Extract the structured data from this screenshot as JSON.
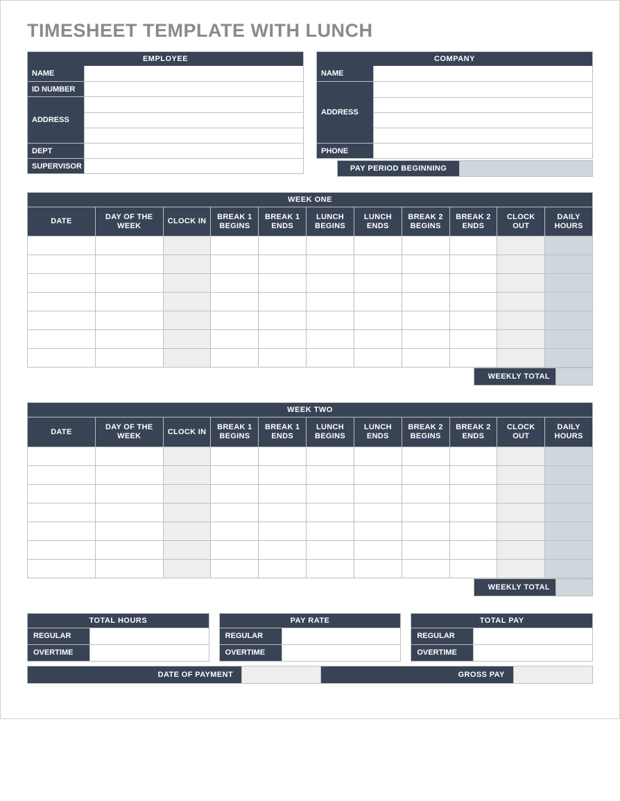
{
  "title": "TIMESHEET TEMPLATE WITH LUNCH",
  "employee": {
    "heading": "EMPLOYEE",
    "fields": {
      "name": "NAME",
      "id_number": "ID NUMBER",
      "address": "ADDRESS",
      "dept": "DEPT",
      "supervisor": "SUPERVISOR"
    },
    "values": {
      "name": "",
      "id_number": "",
      "address": [
        "",
        "",
        ""
      ],
      "dept": "",
      "supervisor": ""
    }
  },
  "company": {
    "heading": "COMPANY",
    "fields": {
      "name": "NAME",
      "address": "ADDRESS",
      "phone": "PHONE"
    },
    "values": {
      "name": "",
      "address": [
        "",
        "",
        "",
        ""
      ],
      "phone": ""
    },
    "pay_period_label": "PAY PERIOD BEGINNING",
    "pay_period_value": ""
  },
  "week_columns": [
    "DATE",
    "DAY OF THE WEEK",
    "CLOCK IN",
    "BREAK 1 BEGINS",
    "BREAK 1 ENDS",
    "LUNCH BEGINS",
    "LUNCH ENDS",
    "BREAK 2 BEGINS",
    "BREAK 2 ENDS",
    "CLOCK OUT",
    "DAILY HOURS"
  ],
  "week_one": {
    "heading": "WEEK ONE",
    "weekly_total_label": "WEEKLY TOTAL",
    "weekly_total_value": ""
  },
  "week_two": {
    "heading": "WEEK TWO",
    "weekly_total_label": "WEEKLY TOTAL",
    "weekly_total_value": ""
  },
  "summary": {
    "total_hours": {
      "heading": "TOTAL HOURS",
      "regular_label": "REGULAR",
      "overtime_label": "OVERTIME",
      "regular": "",
      "overtime": ""
    },
    "pay_rate": {
      "heading": "PAY RATE",
      "regular_label": "REGULAR",
      "overtime_label": "OVERTIME",
      "regular": "",
      "overtime": ""
    },
    "total_pay": {
      "heading": "TOTAL PAY",
      "regular_label": "REGULAR",
      "overtime_label": "OVERTIME",
      "regular": "",
      "overtime": ""
    }
  },
  "footer": {
    "date_of_payment_label": "DATE OF PAYMENT",
    "date_of_payment_value": "",
    "gross_pay_label": "GROSS PAY",
    "gross_pay_value": ""
  }
}
